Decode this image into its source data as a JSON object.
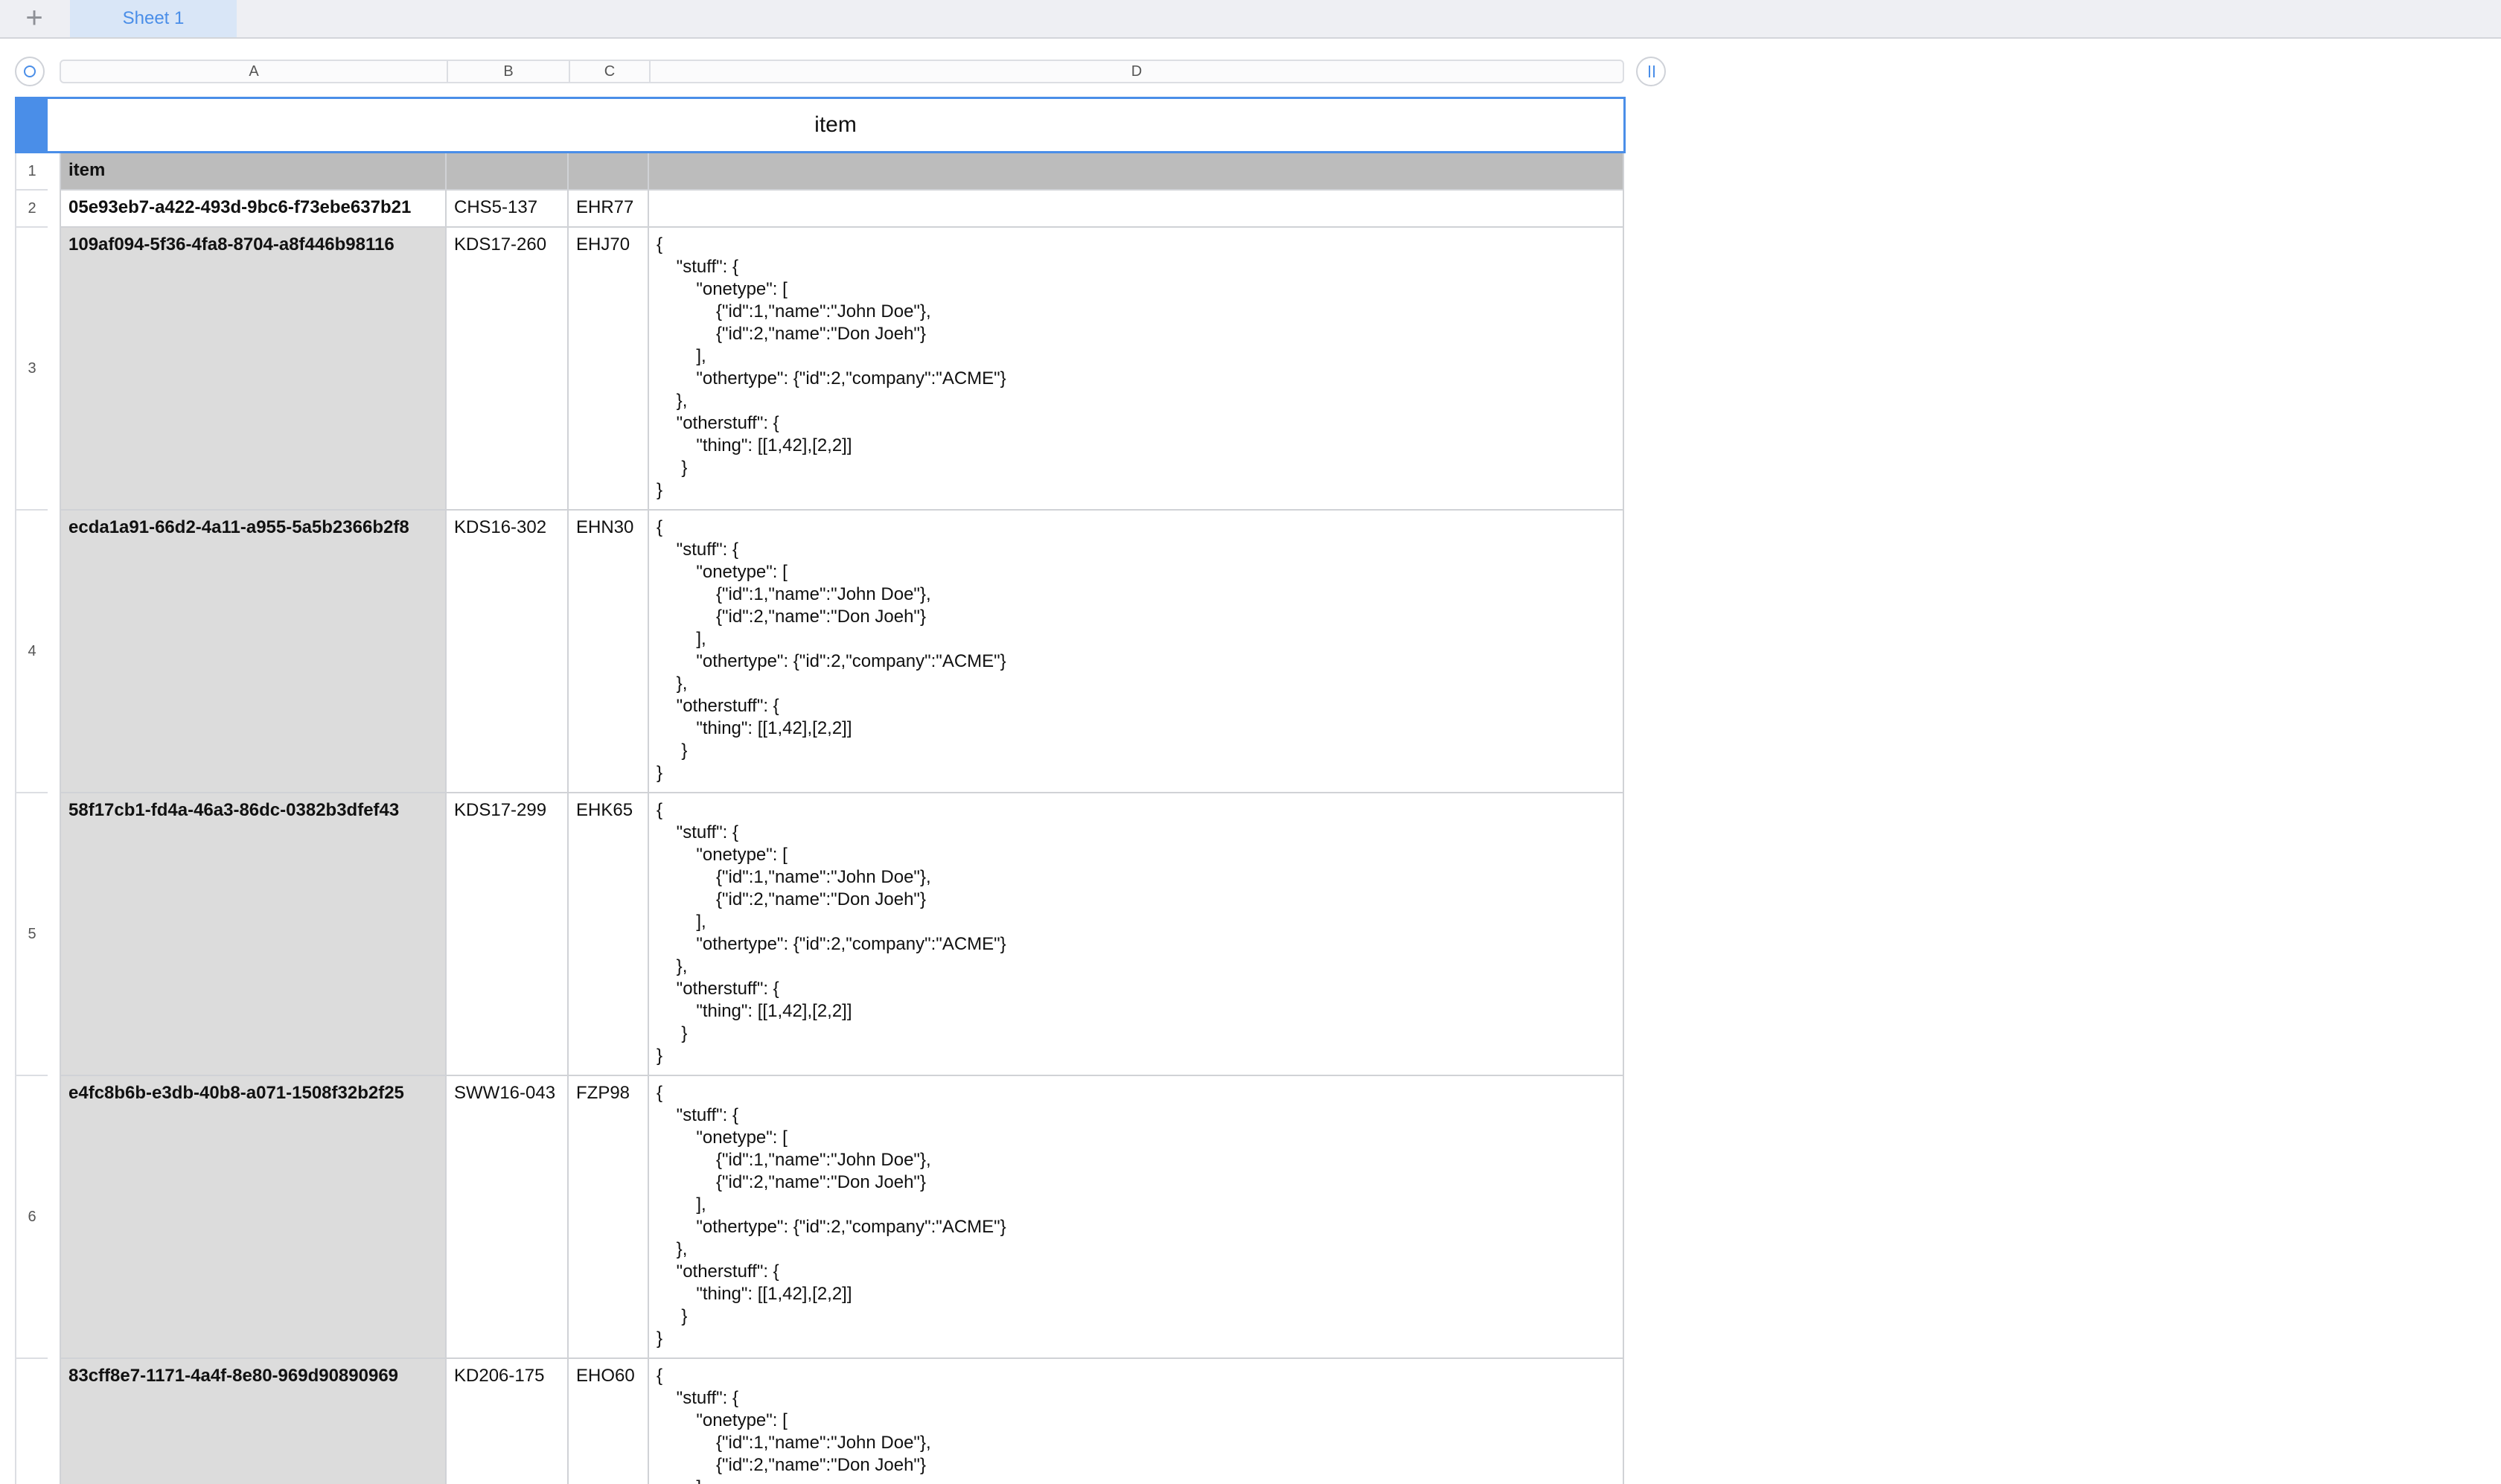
{
  "toolbar": {
    "add_sheet_icon": "plus-icon",
    "sheet_tab_label": "Sheet 1"
  },
  "columns": [
    "A",
    "B",
    "C",
    "D"
  ],
  "table": {
    "title": "item",
    "header_row": {
      "number": "1",
      "a": "item",
      "b": "",
      "c": "",
      "d": ""
    },
    "rows": [
      {
        "number": "2",
        "a": "05e93eb7-a422-493d-9bc6-f73ebe637b21",
        "b": "CHS5-137",
        "c": "EHR77",
        "d": ""
      },
      {
        "number": "3",
        "a": "109af094-5f36-4fa8-8704-a8f446b98116",
        "b": "KDS17-260",
        "c": "EHJ70",
        "d": "{\n    \"stuff\": {\n        \"onetype\": [\n            {\"id\":1,\"name\":\"John Doe\"},\n            {\"id\":2,\"name\":\"Don Joeh\"}\n        ],\n        \"othertype\": {\"id\":2,\"company\":\"ACME\"}\n    },\n    \"otherstuff\": {\n        \"thing\": [[1,42],[2,2]]\n     }\n}"
      },
      {
        "number": "4",
        "a": "ecda1a91-66d2-4a11-a955-5a5b2366b2f8",
        "b": "KDS16-302",
        "c": "EHN30",
        "d": "{\n    \"stuff\": {\n        \"onetype\": [\n            {\"id\":1,\"name\":\"John Doe\"},\n            {\"id\":2,\"name\":\"Don Joeh\"}\n        ],\n        \"othertype\": {\"id\":2,\"company\":\"ACME\"}\n    },\n    \"otherstuff\": {\n        \"thing\": [[1,42],[2,2]]\n     }\n}"
      },
      {
        "number": "5",
        "a": "58f17cb1-fd4a-46a3-86dc-0382b3dfef43",
        "b": "KDS17-299",
        "c": "EHK65",
        "d": "{\n    \"stuff\": {\n        \"onetype\": [\n            {\"id\":1,\"name\":\"John Doe\"},\n            {\"id\":2,\"name\":\"Don Joeh\"}\n        ],\n        \"othertype\": {\"id\":2,\"company\":\"ACME\"}\n    },\n    \"otherstuff\": {\n        \"thing\": [[1,42],[2,2]]\n     }\n}"
      },
      {
        "number": "6",
        "a": "e4fc8b6b-e3db-40b8-a071-1508f32b2f25",
        "b": "SWW16-043",
        "c": "FZP98",
        "d": "{\n    \"stuff\": {\n        \"onetype\": [\n            {\"id\":1,\"name\":\"John Doe\"},\n            {\"id\":2,\"name\":\"Don Joeh\"}\n        ],\n        \"othertype\": {\"id\":2,\"company\":\"ACME\"}\n    },\n    \"otherstuff\": {\n        \"thing\": [[1,42],[2,2]]\n     }\n}"
      },
      {
        "number": "",
        "a": "83cff8e7-1171-4a4f-8e80-969d90890969",
        "b": "KD206-175",
        "c": "EHO60",
        "d": "{\n    \"stuff\": {\n        \"onetype\": [\n            {\"id\":1,\"name\":\"John Doe\"},\n            {\"id\":2,\"name\":\"Don Joeh\"}\n        ],"
      }
    ]
  },
  "colors": {
    "accent": "#4a8ee8",
    "header_row_bg": "#bcbcbc",
    "column_a_bg": "#dcdcdc",
    "grid_line": "#d0d2d6"
  }
}
